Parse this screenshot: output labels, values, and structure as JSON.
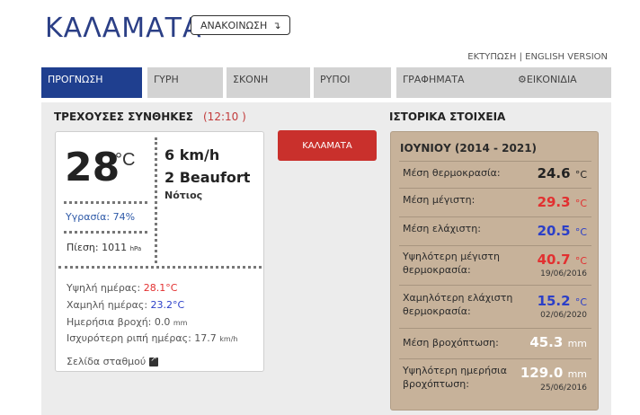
{
  "header": {
    "title": "ΚΑΛΑΜΑΤΑ",
    "announcement_label": "ΑΝΑΚΟΙΝΩΣΗ",
    "announcement_icon": "↴",
    "print_label": "ΕΚΤΥΠΩΣΗ",
    "separator": " | ",
    "english_label": "ENGLISH VERSION"
  },
  "tabs": [
    {
      "label": "ΠΡΟΓΝΩΣΗ",
      "active": true
    },
    {
      "label": "ΓΥΡΗ"
    },
    {
      "label": "ΣΚΟΝΗ"
    },
    {
      "label": "ΡΥΠΟΙ"
    },
    {
      "label": "ΓΡΑΦΗΜΑΤΑ"
    },
    {
      "label": "ΕΙΚΟΝΙΔΙΑ",
      "icon": "⚙"
    }
  ],
  "current": {
    "title": "ΤΡΕΧΟΥΣΕΣ ΣΥΝΘΗΚΕΣ",
    "time": "(12:10 )",
    "temperature": "28",
    "temp_unit": "°C",
    "wind_speed": "6 km/h",
    "wind_beaufort": "2 Beaufort",
    "wind_direction": "Νότιος",
    "humidity_label": "Υγρασία:",
    "humidity_value": "74%",
    "pressure_label": "Πίεση:",
    "pressure_value": "1011",
    "pressure_unit": "hPa",
    "high_label": "Υψηλή ημέρας:",
    "high_value": "28.1°C",
    "low_label": "Χαμηλή ημέρας:",
    "low_value": "23.2°C",
    "rain_label": "Ημερήσια βροχή:",
    "rain_value": "0.0",
    "rain_unit": "mm",
    "gust_label": "Ισχυρότερη ριπή ημέρας:",
    "gust_value": "17.7",
    "gust_unit": "km/h",
    "station_label": "Σελίδα σταθμού"
  },
  "station_button": "ΚΑΛΑΜΑΤΑ",
  "history": {
    "title": "ΙΣΤΟΡΙΚΑ ΣΤΟΙΧΕΙΑ",
    "period": "ΙΟΥΝΙΟΥ (2014 - 2021)",
    "rows": [
      {
        "label": "Μέση θερμοκρασία:",
        "value": "24.6",
        "unit": "°C"
      },
      {
        "label": "Μέση μέγιστη:",
        "value": "29.3",
        "unit": "°C"
      },
      {
        "label": "Μέση ελάχιστη:",
        "value": "20.5",
        "unit": "°C"
      },
      {
        "label1": "Υψηλότερη μέγιστη",
        "label2": "θερμοκρασία:",
        "value": "40.7",
        "unit": "°C",
        "date": "19/06/2016"
      },
      {
        "label1": "Χαμηλότερη ελάχιστη",
        "label2": "θερμοκρασία:",
        "value": "15.2",
        "unit": "°C",
        "date": "02/06/2020"
      },
      {
        "label": "Μέση βροχόπτωση:",
        "value": "45.3",
        "unit": "mm"
      },
      {
        "label1": "Υψηλότερη ημερήσια",
        "label2": "βροχόπτωση:",
        "value": "129.0",
        "unit": "mm",
        "date": "25/06/2016"
      }
    ]
  },
  "colors": {
    "title_blue": "#2b3f86",
    "active_tab": "#1f3f8f",
    "red_button": "#c9302c",
    "history_bg": "#c7b29a"
  }
}
